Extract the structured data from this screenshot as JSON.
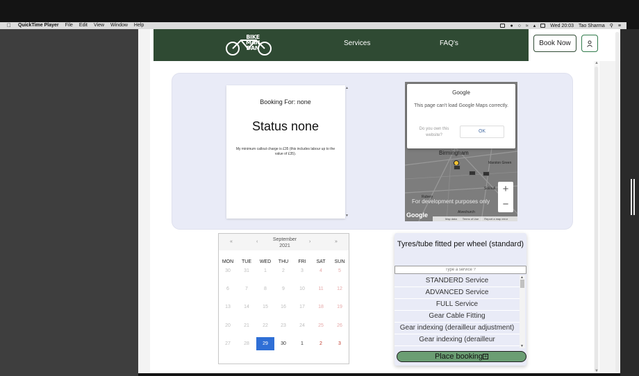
{
  "menubar": {
    "app_name": "QuickTime Player",
    "menus": [
      "File",
      "Edit",
      "View",
      "Window",
      "Help"
    ],
    "clock": "Wed 20:03",
    "user": "Tao Sharma"
  },
  "navbar": {
    "logo_text": "BIKE MAN DAN",
    "services": "Services",
    "faqs": "FAQ's",
    "book_now": "Book Now"
  },
  "booking": {
    "booking_for": "Booking For: none",
    "status": "Status none",
    "note": "My minimum callout charge is £35 (this includes labour up to the value of £35)."
  },
  "map": {
    "dialog_title": "Google",
    "message": "This page can't load Google Maps correctly.",
    "own_question": "Do you own this website?",
    "ok": "OK",
    "city": "Birmingham",
    "dev_note": "For development purposes only",
    "logo": "Google",
    "footer": [
      "Map data",
      "Terms of Use",
      "Report a map error"
    ],
    "labels": [
      "Marston Green",
      "Solihull",
      "Rubery",
      "Alvechurch"
    ]
  },
  "calendar": {
    "month": "September",
    "year": "2021",
    "nav": [
      "«",
      "‹",
      "›",
      "»"
    ],
    "weekdays": [
      "MON",
      "TUE",
      "WED",
      "THU",
      "FRI",
      "SAT",
      "SUN"
    ],
    "weeks": [
      [
        "30",
        "31",
        "1",
        "2",
        "3",
        "4",
        "5"
      ],
      [
        "6",
        "7",
        "8",
        "9",
        "10",
        "11",
        "12"
      ],
      [
        "13",
        "14",
        "15",
        "16",
        "17",
        "18",
        "19"
      ],
      [
        "20",
        "21",
        "22",
        "23",
        "24",
        "25",
        "26"
      ],
      [
        "27",
        "28",
        "29",
        "30",
        "1",
        "2",
        "3"
      ]
    ],
    "selected": "29"
  },
  "services": {
    "title": "Tyres/tube fitted per wheel (standard)",
    "search_placeholder": "Type a service ?",
    "items": [
      "STANDERD Service",
      "ADVANCED Service",
      "FULL Service",
      "Gear Cable Fitting",
      "Gear indexing (derailleur adjustment)",
      "Gear indexing (derailleur"
    ],
    "place_booking": "Place booking"
  },
  "colors": {
    "nav_green": "#2f4a33",
    "hero_bg": "#e9ebf7",
    "selected_day": "#2f6fd6",
    "weekend_red": "#c0392b",
    "place_booking_green": "#6b9e73"
  }
}
